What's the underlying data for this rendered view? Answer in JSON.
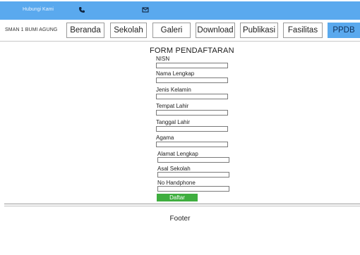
{
  "topbar": {
    "contact_label": "Hubungi Kami",
    "phone_icon": "phone-icon",
    "mail_icon": "mail-icon"
  },
  "nav": {
    "brand": "SMAN 1 BUMI AGUNG",
    "items": [
      {
        "label": "Beranda"
      },
      {
        "label": "Sekolah"
      },
      {
        "label": "Galeri"
      },
      {
        "label": "Download"
      },
      {
        "label": "Publikasi"
      },
      {
        "label": "Fasilitas"
      },
      {
        "label": "PPDB"
      }
    ],
    "active_item": "PPDB"
  },
  "form": {
    "title": "FORM PENDAFTARAN",
    "fields": [
      {
        "label": "NISN"
      },
      {
        "label": "Nama Lengkap"
      },
      {
        "label": "Jenis Kelamin"
      },
      {
        "label": "Tempat Lahir"
      },
      {
        "label": "Tanggal Lahir"
      },
      {
        "label": "Agama"
      },
      {
        "label": "Alamat Lengkap"
      },
      {
        "label": "Asal Sekolah"
      },
      {
        "label": "No Handphone"
      }
    ],
    "submit_label": "Daftar"
  },
  "footer": {
    "text": "Footer"
  },
  "colors": {
    "topbar": "#5aa9ee",
    "active_nav": "#5aa9ee",
    "submit_button": "#3fae3f"
  }
}
